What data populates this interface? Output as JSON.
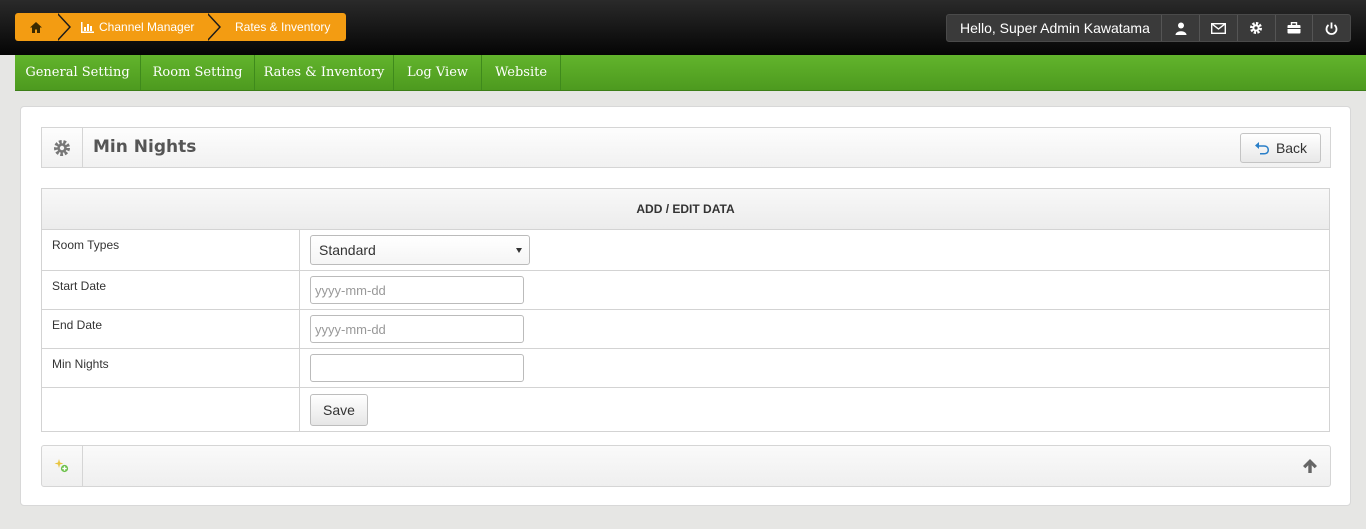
{
  "breadcrumb": {
    "home_icon": "home-icon",
    "channel_manager": "Channel Manager",
    "rates_inventory": "Rates & Inventory"
  },
  "user": {
    "greeting": "Hello, Super Admin Kawatama",
    "icons": [
      "user-icon",
      "envelope-icon",
      "gear-icon",
      "briefcase-icon",
      "power-icon"
    ]
  },
  "nav": {
    "items": [
      {
        "label": "General Setting"
      },
      {
        "label": "Room Setting"
      },
      {
        "label": "Rates & Inventory"
      },
      {
        "label": "Log View"
      },
      {
        "label": "Website"
      }
    ]
  },
  "page": {
    "title": "Min Nights",
    "back_label": "Back"
  },
  "form": {
    "header": "ADD / EDIT DATA",
    "room_types": {
      "label": "Room Types",
      "value": "Standard"
    },
    "start_date": {
      "label": "Start Date",
      "placeholder": "yyyy-mm-dd",
      "value": ""
    },
    "end_date": {
      "label": "End Date",
      "placeholder": "yyyy-mm-dd",
      "value": ""
    },
    "min_nights": {
      "label": "Min Nights",
      "value": ""
    },
    "save_label": "Save"
  },
  "colors": {
    "accent_orange": "#f39c12",
    "nav_green": "#5aab27"
  }
}
